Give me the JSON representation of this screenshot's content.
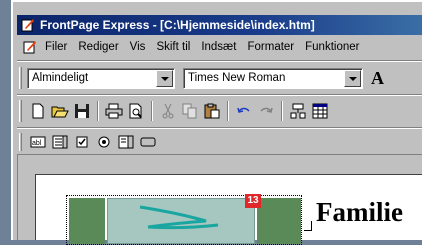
{
  "window": {
    "title": "FrontPage Express - [C:\\Hjemmeside\\index.htm]"
  },
  "menu": {
    "items": [
      "Filer",
      "Rediger",
      "Vis",
      "Skift til",
      "Indsæt",
      "Formater",
      "Funktioner"
    ]
  },
  "format_toolbar": {
    "style_value": "Almindeligt",
    "font_value": "Times New Roman",
    "grow_font_glyph": "A"
  },
  "standard_toolbar": {
    "icons": [
      "new-icon",
      "open-icon",
      "save-icon",
      "print-icon",
      "print-preview-icon",
      "cut-icon",
      "copy-icon",
      "paste-icon",
      "undo-icon",
      "redo-icon",
      "table-icon",
      "insert-table-icon"
    ]
  },
  "forms_toolbar": {
    "icons": [
      "textbox-icon",
      "textarea-icon",
      "checkbox-icon",
      "radio-icon",
      "dropdown-icon",
      "button-icon"
    ]
  },
  "document": {
    "heading": "Familie",
    "badge": "13"
  },
  "colors": {
    "titlebar_start": "#0a246a",
    "desktop": "#6f8196",
    "cell_green": "#5a8a57",
    "badge_red": "#e0272a"
  }
}
